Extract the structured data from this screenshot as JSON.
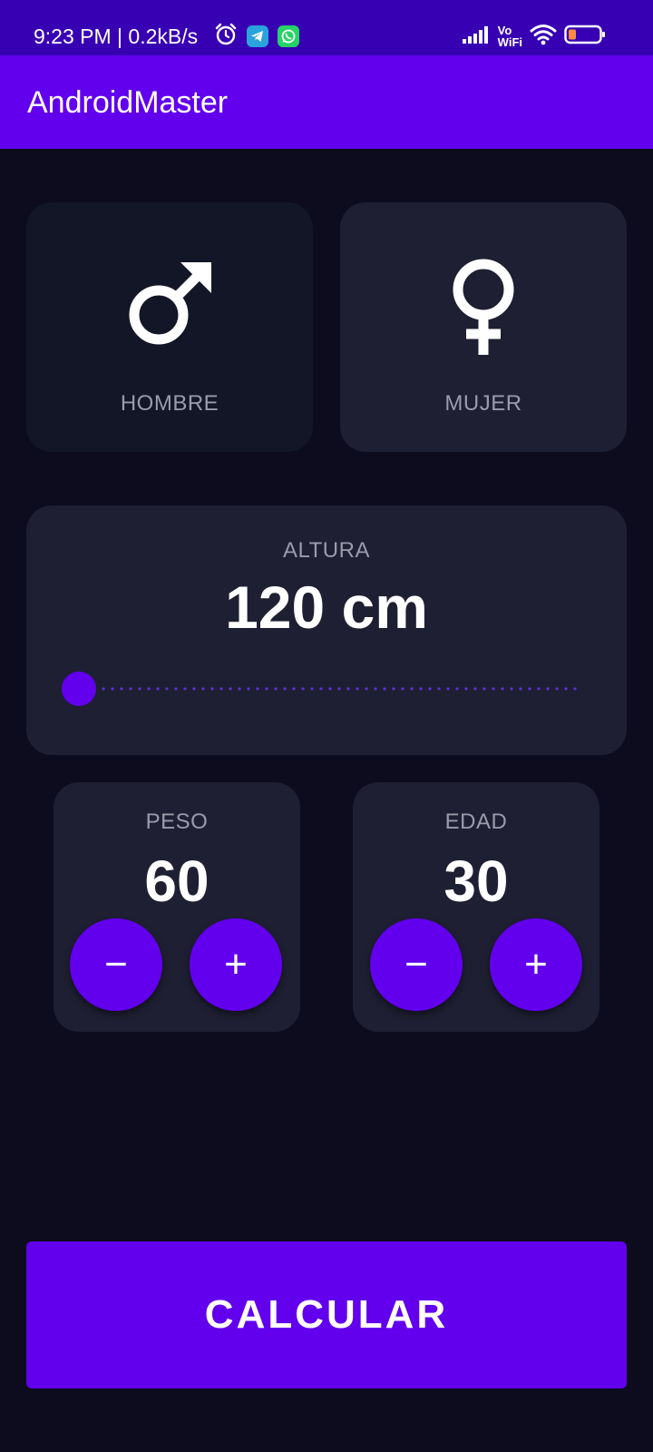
{
  "status_bar": {
    "time_speed": "9:23 PM | 0.2kB/s",
    "icons": [
      "alarm-icon",
      "telegram-icon",
      "whatsapp-icon",
      "signal-icon",
      "vowifi-icon",
      "wifi-icon",
      "battery-icon"
    ],
    "vowifi_top": "Vo",
    "vowifi_bottom": "WiFi"
  },
  "appbar": {
    "title": "AndroidMaster"
  },
  "gender": {
    "male": {
      "label": "HOMBRE",
      "icon": "male-symbol-icon",
      "selected": true
    },
    "female": {
      "label": "MUJER",
      "icon": "female-symbol-icon",
      "selected": false
    }
  },
  "height": {
    "label": "ALTURA",
    "value_text": "120 cm",
    "slider_level": 0.0
  },
  "weight": {
    "label": "PESO",
    "value": "60",
    "minus": "−",
    "plus": "+"
  },
  "age": {
    "label": "EDAD",
    "value": "30",
    "minus": "−",
    "plus": "+"
  },
  "calculate": {
    "label": "CALCULAR"
  },
  "colors": {
    "status_bar": "#3700b3",
    "app_bar": "#6200ee",
    "background": "#0d0c1e",
    "card": "#1e1f32",
    "card_selected": "#131626",
    "accent": "#6200ee"
  }
}
